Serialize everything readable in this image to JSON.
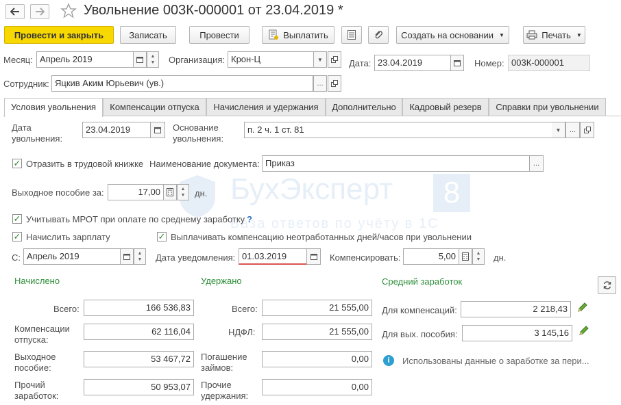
{
  "window": {
    "title": "Увольнение 003К-000001 от 23.04.2019 *"
  },
  "toolbar": {
    "post_and_close": "Провести и закрыть",
    "save": "Записать",
    "post": "Провести",
    "pay": "Выплатить",
    "create_based_on": "Создать на основании",
    "print": "Печать"
  },
  "header": {
    "month_label": "Месяц:",
    "month_value": "Апрель 2019",
    "org_label": "Организация:",
    "org_value": "Крон-Ц",
    "date_label": "Дата:",
    "date_value": "23.04.2019",
    "number_label": "Номер:",
    "number_value": "003К-000001",
    "employee_label": "Сотрудник:",
    "employee_value": "Яцкив Аким Юрьевич (ув.)"
  },
  "tabs": [
    {
      "label": "Условия увольнения",
      "active": true
    },
    {
      "label": "Компенсации отпуска"
    },
    {
      "label": "Начисления и удержания"
    },
    {
      "label": "Дополнительно"
    },
    {
      "label": "Кадровый резерв"
    },
    {
      "label": "Справки при увольнении"
    }
  ],
  "conditions": {
    "dismissal_date_label": "Дата\nувольнения:",
    "dismissal_date_value": "23.04.2019",
    "basis_label": "Основание\nувольнения:",
    "basis_value": "п. 2 ч. 1 ст. 81",
    "record_book_label": "Отразить в трудовой книжке",
    "doc_name_label": "Наименование документа:",
    "doc_name_value": "Приказ",
    "severance_label": "Выходное пособие за:",
    "severance_value": "17,00",
    "severance_unit": "дн.",
    "mrot_label": "Учитывать МРОТ при оплате по среднему заработку",
    "mrot_help": "?",
    "accrue_salary_label": "Начислить зарплату",
    "pay_comp_label": "Выплачивать компенсацию неотработанных дней/часов при увольнении",
    "from_label": "С:",
    "from_value": "Апрель 2019",
    "notice_date_label": "Дата уведомления:",
    "notice_date_value": "01.03.2019",
    "compensate_label": "Компенсировать:",
    "compensate_value": "5,00",
    "compensate_unit": "дн."
  },
  "accrued": {
    "header": "Начислено",
    "total_label": "Всего:",
    "total_value": "166 536,83",
    "vacation_label": "Компенсации\nотпуска:",
    "vacation_value": "62 116,04",
    "severance_label": "Выходное\nпособие:",
    "severance_value": "53 467,72",
    "other_label": "Прочий\nзаработок:",
    "other_value": "50 953,07"
  },
  "withheld": {
    "header": "Удержано",
    "total_label": "Всего:",
    "total_value": "21 555,00",
    "ndfl_label": "НДФЛ:",
    "ndfl_value": "21 555,00",
    "loans_label": "Погашение\nзаймов:",
    "loans_value": "0,00",
    "other_label": "Прочие\nудержания:",
    "other_value": "0,00"
  },
  "avg": {
    "header": "Средний заработок",
    "comp_label": "Для компенсаций:",
    "comp_value": "2 218,43",
    "sev_label": "Для вых. пособия:",
    "sev_value": "3 145,16",
    "info": "Использованы данные о заработке за пери..."
  },
  "watermark": {
    "brand": "БухЭксперт",
    "digit": "8",
    "tagline": "База ответов по учёту в 1С"
  },
  "colors": {
    "primary": "#f7d800",
    "section_green": "#2f8f3a",
    "check_green": "#2e8b2e",
    "error_underline": "#d9534f",
    "info_blue": "#2f9fd0"
  }
}
